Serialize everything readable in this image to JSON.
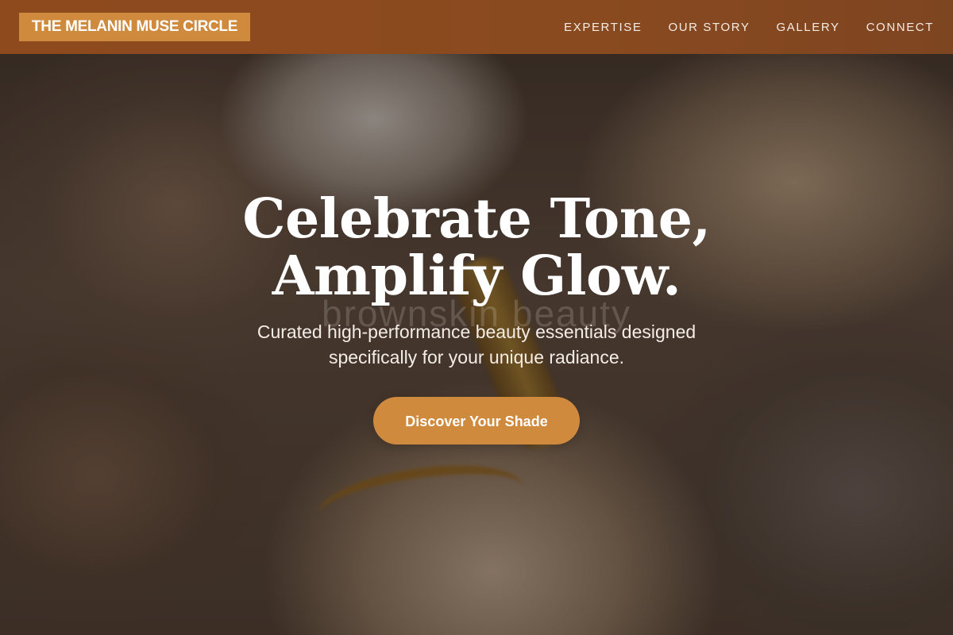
{
  "header": {
    "brand": "THE MELANIN MUSE CIRCLE",
    "nav": [
      {
        "label": "EXPERTISE"
      },
      {
        "label": "OUR STORY"
      },
      {
        "label": "GALLERY"
      },
      {
        "label": "CONNECT"
      }
    ]
  },
  "hero": {
    "title_line1": "Celebrate Tone,",
    "title_line2": "Amplify Glow.",
    "watermark": "brownskin beauty",
    "subtitle_line1": "Curated high-performance beauty essentials designed",
    "subtitle_line2": "specifically for your unique radiance.",
    "cta_label": "Discover Your Shade"
  },
  "colors": {
    "nav_background": "#8a4a1f",
    "accent": "#d08a3e",
    "text_light": "#ffffff"
  }
}
